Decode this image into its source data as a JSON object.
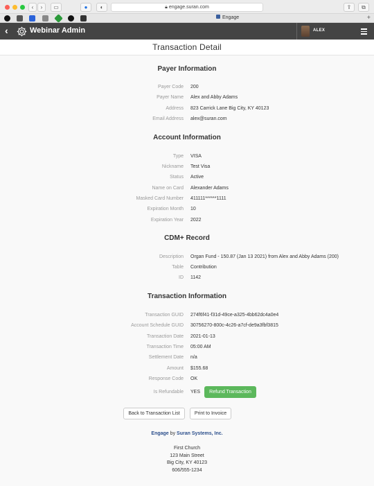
{
  "browser": {
    "url": "engage.suran.com",
    "tab_title": "Engage"
  },
  "app": {
    "title": "Webinar Admin",
    "user": "ALEX"
  },
  "page": {
    "title": "Transaction Detail"
  },
  "payer": {
    "heading": "Payer Information",
    "rows": [
      {
        "label": "Payer Code",
        "value": "200"
      },
      {
        "label": "Payer Name",
        "value": "Alex and Abby Adams"
      },
      {
        "label": "Address",
        "value": "823 Carrick Lane Big City, KY 40123"
      },
      {
        "label": "Email Address",
        "value": "alex@suran.com"
      }
    ]
  },
  "account": {
    "heading": "Account Information",
    "rows": [
      {
        "label": "Type",
        "value": "VISA"
      },
      {
        "label": "Nickname",
        "value": "Test Visa"
      },
      {
        "label": "Status",
        "value": "Active"
      },
      {
        "label": "Name on Card",
        "value": "Alexander Adams"
      },
      {
        "label": "Masked Card Number",
        "value": "411111******1111"
      },
      {
        "label": "Expiration Month",
        "value": "10"
      },
      {
        "label": "Expiration Year",
        "value": "2022"
      }
    ]
  },
  "cdm": {
    "heading": "CDM+ Record",
    "rows": [
      {
        "label": "Description",
        "value": "Organ Fund - 150.87 (Jan 13 2021) from Alex and Abby Adams (200)"
      },
      {
        "label": "Table",
        "value": "Contribution"
      },
      {
        "label": "ID",
        "value": "1142"
      }
    ]
  },
  "transaction": {
    "heading": "Transaction Information",
    "rows": [
      {
        "label": "Transaction GUID",
        "value": "274f6f41-f31d-49ce-a325-4bb62dc4a0e4"
      },
      {
        "label": "Account Schedule GUID",
        "value": "30756270-800c-4c26-a7cf-de9a3fbf3815"
      },
      {
        "label": "Transaction Date",
        "value": "2021-01-13"
      },
      {
        "label": "Transaction Time",
        "value": "05:00 AM"
      },
      {
        "label": "Settlement Date",
        "value": "n/a"
      },
      {
        "label": "Amount",
        "value": "$155.68"
      },
      {
        "label": "Response Code",
        "value": "OK"
      },
      {
        "label": "Is Refundable",
        "value": "YES"
      }
    ],
    "refund_label": "Refund Transaction"
  },
  "actions": {
    "back_label": "Back to Transaction List",
    "print_label": "Print to Invoice"
  },
  "footer": {
    "brand_name": "Engage",
    "by": "by",
    "company": "Suran Systems, Inc.",
    "address_lines": [
      "First Church",
      "123 Main Street",
      "Big City, KY 40123",
      "606/555-1234"
    ]
  },
  "colors": {
    "appbar": "#444444",
    "refund_button": "#5cb85c",
    "brand": "#2c4f8c"
  }
}
